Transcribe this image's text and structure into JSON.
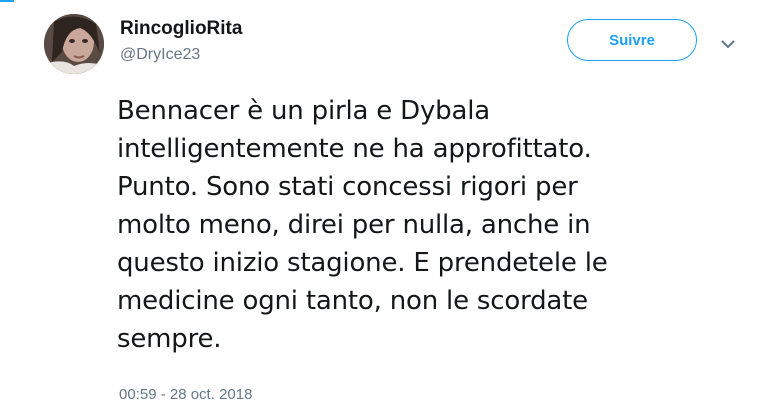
{
  "author": {
    "display_name": "RincoglioRita",
    "handle": "@DryIce23"
  },
  "actions": {
    "follow_label": "Suivre",
    "more_icon": "chevron-down-icon"
  },
  "tweet": {
    "lines": [
      "Bennacer è un pirla e Dybala",
      "intelligentemente ne ha approfittato.",
      "Punto. Sono stati concessi rigori per",
      "molto meno, direi per nulla, anche in",
      "questo inizio stagione. E prendetele le",
      "medicine ogni tanto, non le scordate",
      "sempre."
    ],
    "timestamp": "00:59 - 28 oct. 2018"
  },
  "colors": {
    "accent": "#1da1f2",
    "secondary_text": "#657786",
    "primary_text": "#14171a"
  }
}
